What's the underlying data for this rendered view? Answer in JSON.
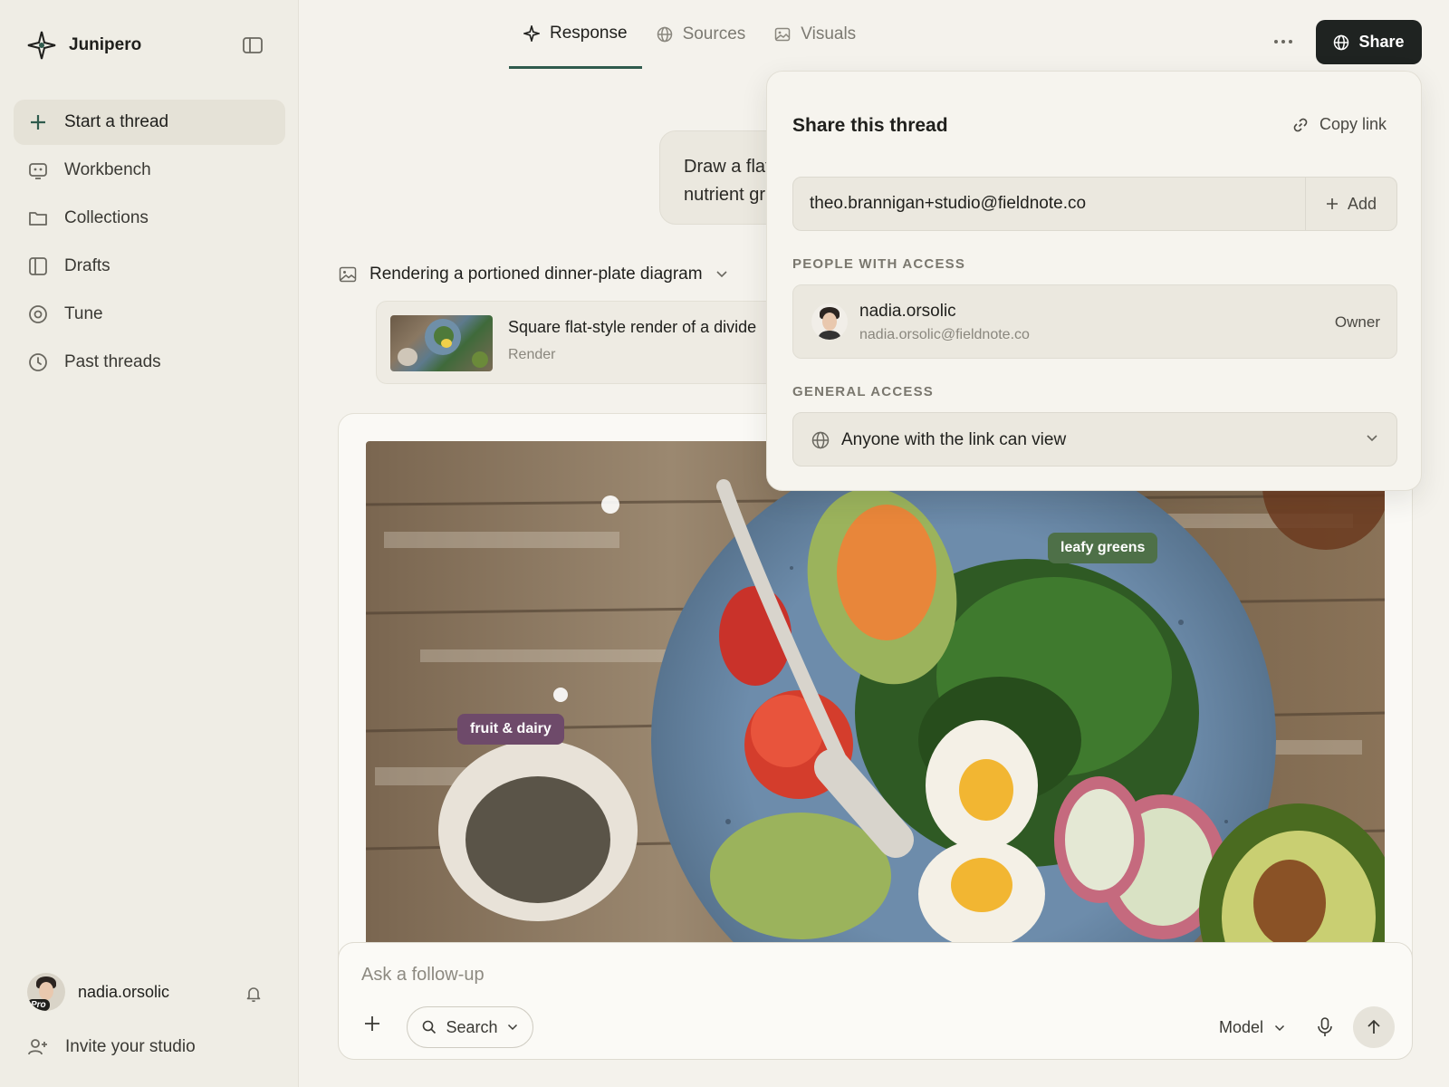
{
  "app": {
    "name": "Junipero"
  },
  "sidebar": {
    "items": [
      {
        "label": "Start a thread",
        "icon": "plus-icon",
        "active": true
      },
      {
        "label": "Workbench",
        "icon": "workbench-icon"
      },
      {
        "label": "Collections",
        "icon": "folder-icon"
      },
      {
        "label": "Drafts",
        "icon": "drafts-icon"
      },
      {
        "label": "Tune",
        "icon": "tune-icon"
      },
      {
        "label": "Past threads",
        "icon": "clock-icon"
      }
    ],
    "user": {
      "name": "nadia.orsolic",
      "badge": "Pro"
    },
    "invite_label": "Invite your studio"
  },
  "tabs": [
    {
      "label": "Response",
      "icon": "sparkle-icon",
      "active": true
    },
    {
      "label": "Sources",
      "icon": "globe-icon"
    },
    {
      "label": "Visuals",
      "icon": "image-icon"
    }
  ],
  "header": {
    "share_label": "Share"
  },
  "chat": {
    "user_message_lines": [
      "Draw a flat",
      "nutrient gr"
    ],
    "status_text": "Rendering a portioned dinner-plate diagram",
    "render_card": {
      "title": "Square flat-style render of a divide",
      "subtitle": "Render"
    },
    "image_labels": {
      "fruit": "fruit & dairy",
      "greens": "leafy greens"
    }
  },
  "composer": {
    "placeholder": "Ask a follow-up",
    "search_label": "Search",
    "model_label": "Model"
  },
  "share_panel": {
    "title": "Share this thread",
    "copy_link_label": "Copy link",
    "email_value": "theo.brannigan+studio@fieldnote.co",
    "add_label": "Add",
    "people_heading": "PEOPLE WITH ACCESS",
    "person": {
      "name": "nadia.orsolic",
      "email": "nadia.orsolic@fieldnote.co",
      "role": "Owner"
    },
    "general_heading": "GENERAL ACCESS",
    "general_access_value": "Anyone with the link can view"
  },
  "colors": {
    "accent": "#2f5b4d",
    "share_button": "#1f2321",
    "chip_fruit": "#6e4a6a",
    "chip_greens": "#4e7048"
  }
}
